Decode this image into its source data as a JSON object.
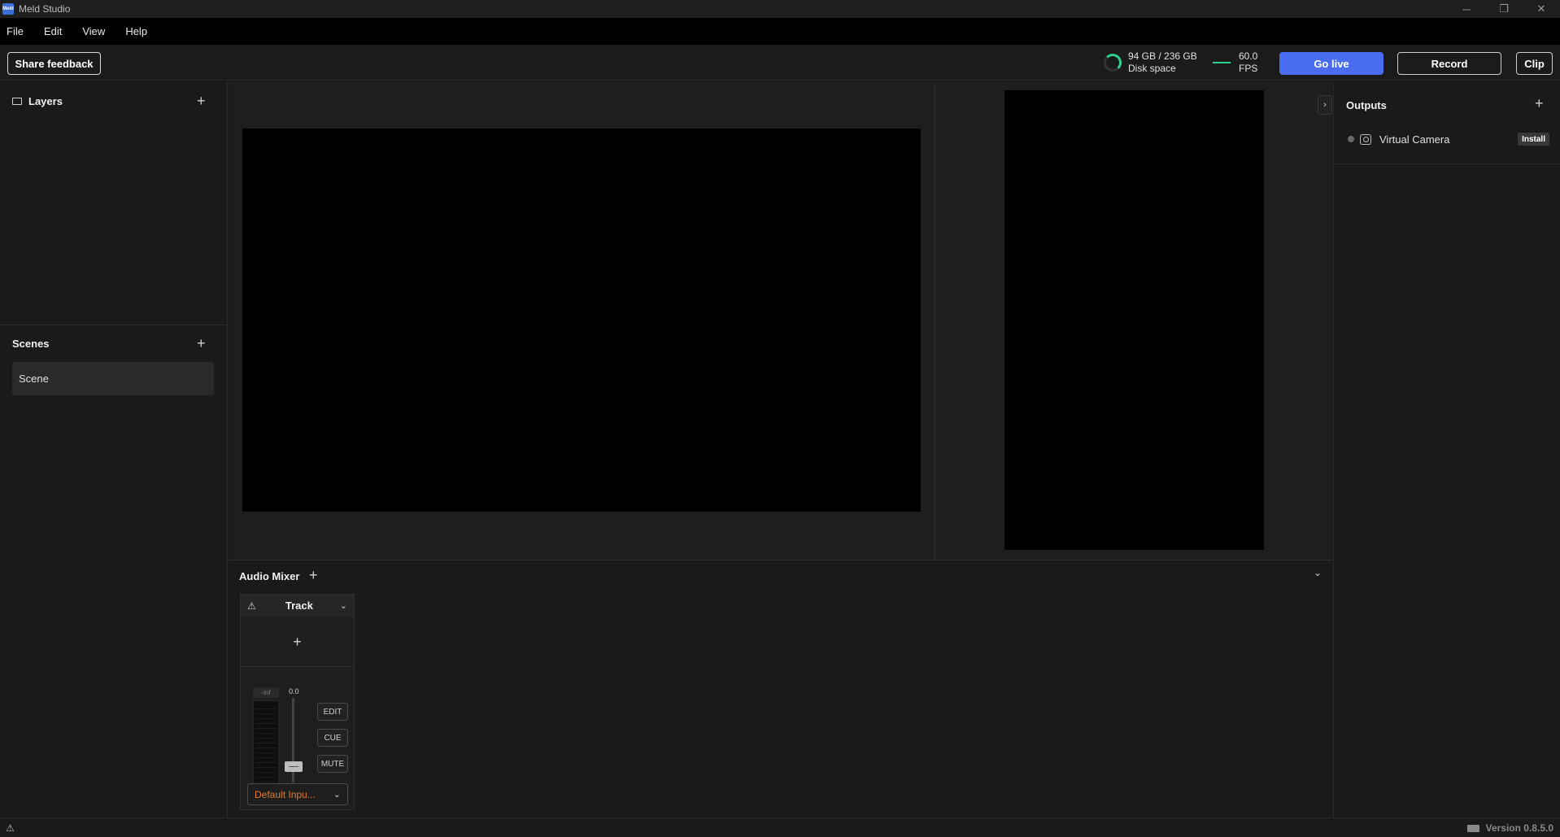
{
  "window": {
    "title": "Meld Studio",
    "logo_text": "Meld",
    "controls": {
      "minimize": "─",
      "restore": "❐",
      "close": "✕"
    }
  },
  "menu": [
    "File",
    "Edit",
    "View",
    "Help"
  ],
  "toolbar": {
    "share_feedback": "Share feedback",
    "disk_usage": "94 GB / 236 GB",
    "disk_label": "Disk space",
    "fps_value": "60.0",
    "fps_label": "FPS",
    "go_live": "Go live",
    "record": "Record",
    "clip": "Clip"
  },
  "layers": {
    "title": "Layers",
    "add": "+"
  },
  "scenes": {
    "title": "Scenes",
    "add": "+",
    "items": [
      "Scene"
    ]
  },
  "outputs": {
    "title": "Outputs",
    "add": "+",
    "items": [
      {
        "label": "Virtual Camera",
        "action": "Install"
      }
    ]
  },
  "preview": {
    "expand_icon": "›"
  },
  "audio_mixer": {
    "title": "Audio Mixer",
    "add": "+",
    "collapse_icon": "⌄",
    "tracks": [
      {
        "name": "Track",
        "add": "+",
        "meter_label": "-inf",
        "fader_value": "0.0",
        "buttons": {
          "edit": "EDIT",
          "cue": "CUE",
          "mute": "MUTE"
        },
        "device": "Default Inpu..."
      }
    ]
  },
  "status": {
    "version": "Version 0.8.5.0"
  },
  "colors": {
    "go_live": "#4a6cf0",
    "accent_green": "#2fd18c",
    "device_orange": "#e07b2e"
  }
}
